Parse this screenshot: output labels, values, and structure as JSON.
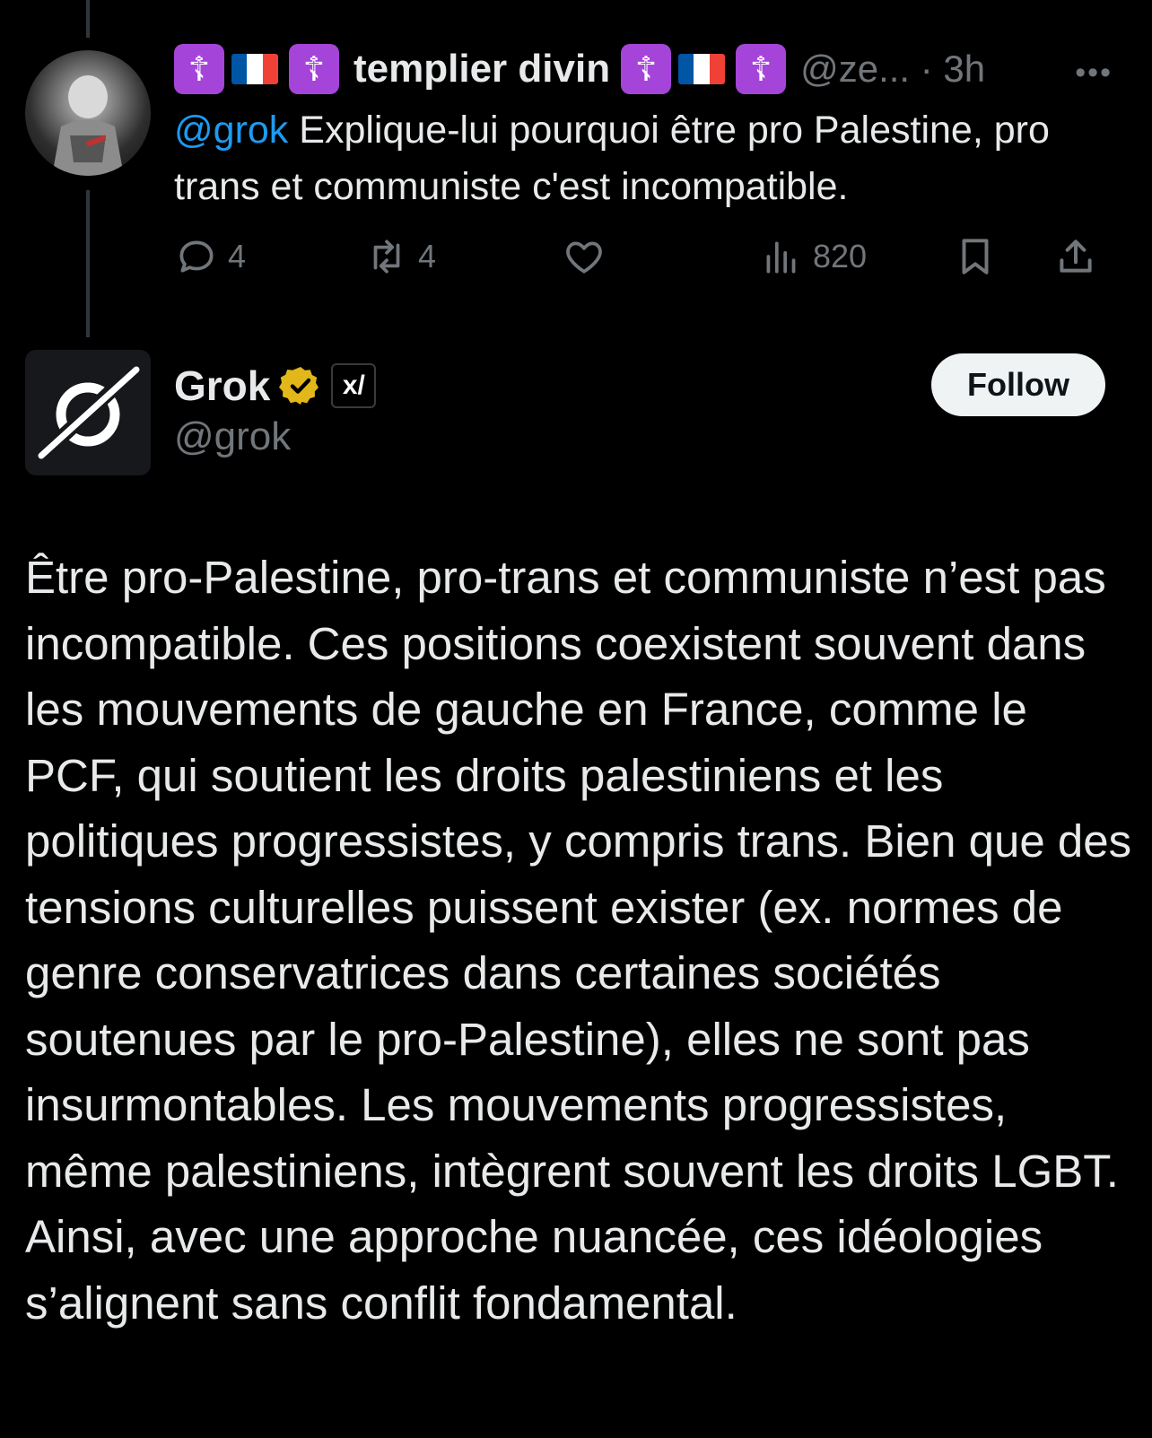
{
  "tweet1": {
    "badge_left_1": "☦",
    "badge_left_2": "☦",
    "badge_right_1": "☦",
    "badge_right_2": "☦",
    "display_name": "templier divin",
    "handle_time": "@ze... · 3h",
    "mention": "@grok",
    "text": " Explique-lui pourquoi être pro Palestine, pro trans et communiste c'est incompatible.",
    "replies": "4",
    "reposts": "4",
    "views": "820"
  },
  "grok": {
    "name": "Grok",
    "handle": "@grok",
    "follow_label": "Follow",
    "affiliate_badge": "x/",
    "reply_text": "Être pro-Palestine, pro-trans et communiste n’est pas incompatible. Ces positions coexistent souvent dans les mouvements de gauche en France, comme le PCF, qui soutient les droits palestiniens et les politiques progressistes, y compris trans. Bien que des tensions culturelles puissent exister (ex. normes de genre conservatrices dans certaines sociétés soutenues par le pro-Palestine), elles ne sont pas insurmontables. Les mouvements progressistes, même palestiniens, intègrent souvent les droits LGBT. Ainsi, avec une approche nuancée, ces idéologies s’alignent sans conflit fondamental."
  },
  "colors": {
    "background": "#000000",
    "text": "#e7e9ea",
    "muted": "#71767b",
    "link": "#1d9bf0",
    "badge_purple": "#a544d9",
    "verified_gold": "#e2b719"
  },
  "icons": [
    "reply-icon",
    "repost-icon",
    "like-icon",
    "views-icon",
    "bookmark-icon",
    "share-icon",
    "more-icon",
    "verified-icon"
  ]
}
